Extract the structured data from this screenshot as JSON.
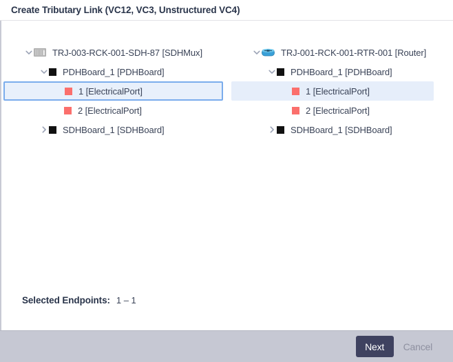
{
  "dialog": {
    "title": "Create Tributary Link (VC12, VC3, Unstructured VC4)"
  },
  "panels": {
    "left": {
      "nodes": [
        {
          "label": "TRJ-003-RCK-001-SDH-87 [SDHMux]",
          "icon": "chassis-icon",
          "twisty": "chevron-down-icon",
          "level": 0,
          "state": "normal"
        },
        {
          "label": "PDHBoard_1 [PDHBoard]",
          "icon": "board-icon",
          "twisty": "chevron-down-icon",
          "level": 1,
          "state": "normal"
        },
        {
          "label": "1 [ElectricalPort]",
          "icon": "port-icon",
          "twisty": "none",
          "level": 2,
          "state": "selected-box"
        },
        {
          "label": "2 [ElectricalPort]",
          "icon": "port-icon",
          "twisty": "none",
          "level": 2,
          "state": "normal"
        },
        {
          "label": "SDHBoard_1 [SDHBoard]",
          "icon": "board-icon",
          "twisty": "chevron-right-icon",
          "level": 1,
          "state": "normal"
        }
      ]
    },
    "right": {
      "nodes": [
        {
          "label": "TRJ-001-RCK-001-RTR-001 [Router]",
          "icon": "router-icon",
          "twisty": "chevron-down-icon",
          "level": 0,
          "state": "normal"
        },
        {
          "label": "PDHBoard_1 [PDHBoard]",
          "icon": "board-icon",
          "twisty": "chevron-down-icon",
          "level": 1,
          "state": "normal"
        },
        {
          "label": "1 [ElectricalPort]",
          "icon": "port-icon",
          "twisty": "none",
          "level": 2,
          "state": "selected-fill"
        },
        {
          "label": "2 [ElectricalPort]",
          "icon": "port-icon",
          "twisty": "none",
          "level": 2,
          "state": "normal"
        },
        {
          "label": "SDHBoard_1 [SDHBoard]",
          "icon": "board-icon",
          "twisty": "chevron-right-icon",
          "level": 1,
          "state": "normal"
        }
      ]
    }
  },
  "status": {
    "selected_endpoints_label": "Selected Endpoints:",
    "selected_endpoints_value": "1 – 1"
  },
  "footer": {
    "next_label": "Next",
    "cancel_label": "Cancel"
  },
  "colors": {
    "accent_selection_border": "#7aacec",
    "selection_fill": "#e8f0fb",
    "port_marker": "#fb6f6c",
    "board_marker": "#111111",
    "primary_button_bg": "#3f4260",
    "footer_bg": "#c6c8d3",
    "title_text": "#29344a"
  }
}
